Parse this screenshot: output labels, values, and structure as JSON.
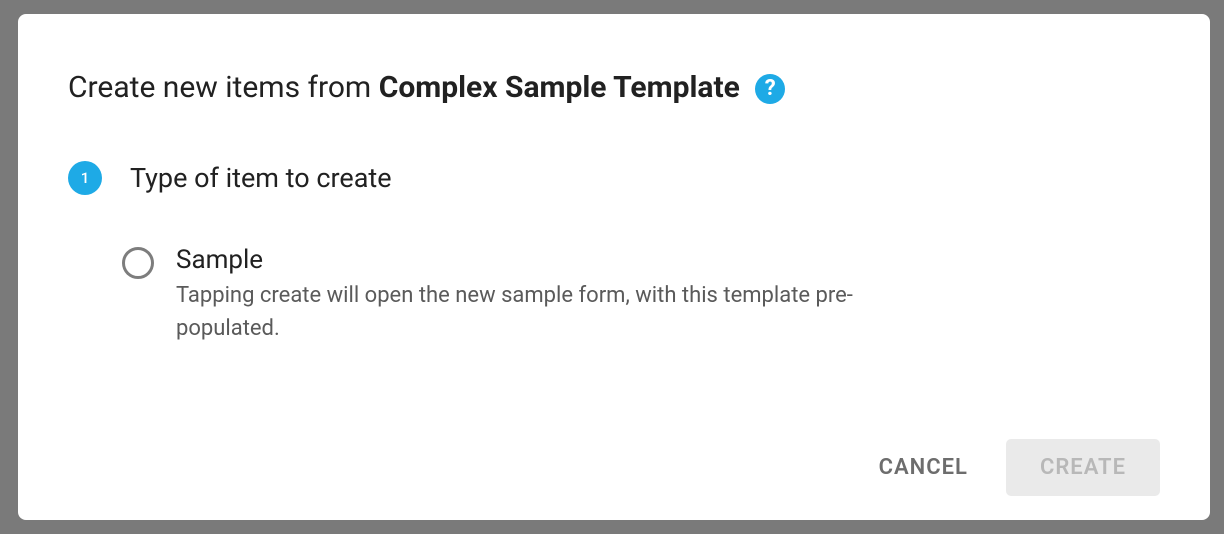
{
  "dialog": {
    "title_prefix": "Create new items from ",
    "title_bold": "Complex Sample Template ",
    "help_glyph": "?"
  },
  "step": {
    "number": "1",
    "title": "Type of item to create"
  },
  "option": {
    "label": "Sample",
    "description": "Tapping create will open the new sample form, with this template pre-populated."
  },
  "actions": {
    "cancel": "CANCEL",
    "create": "CREATE"
  },
  "colors": {
    "accent": "#1eaae6"
  }
}
